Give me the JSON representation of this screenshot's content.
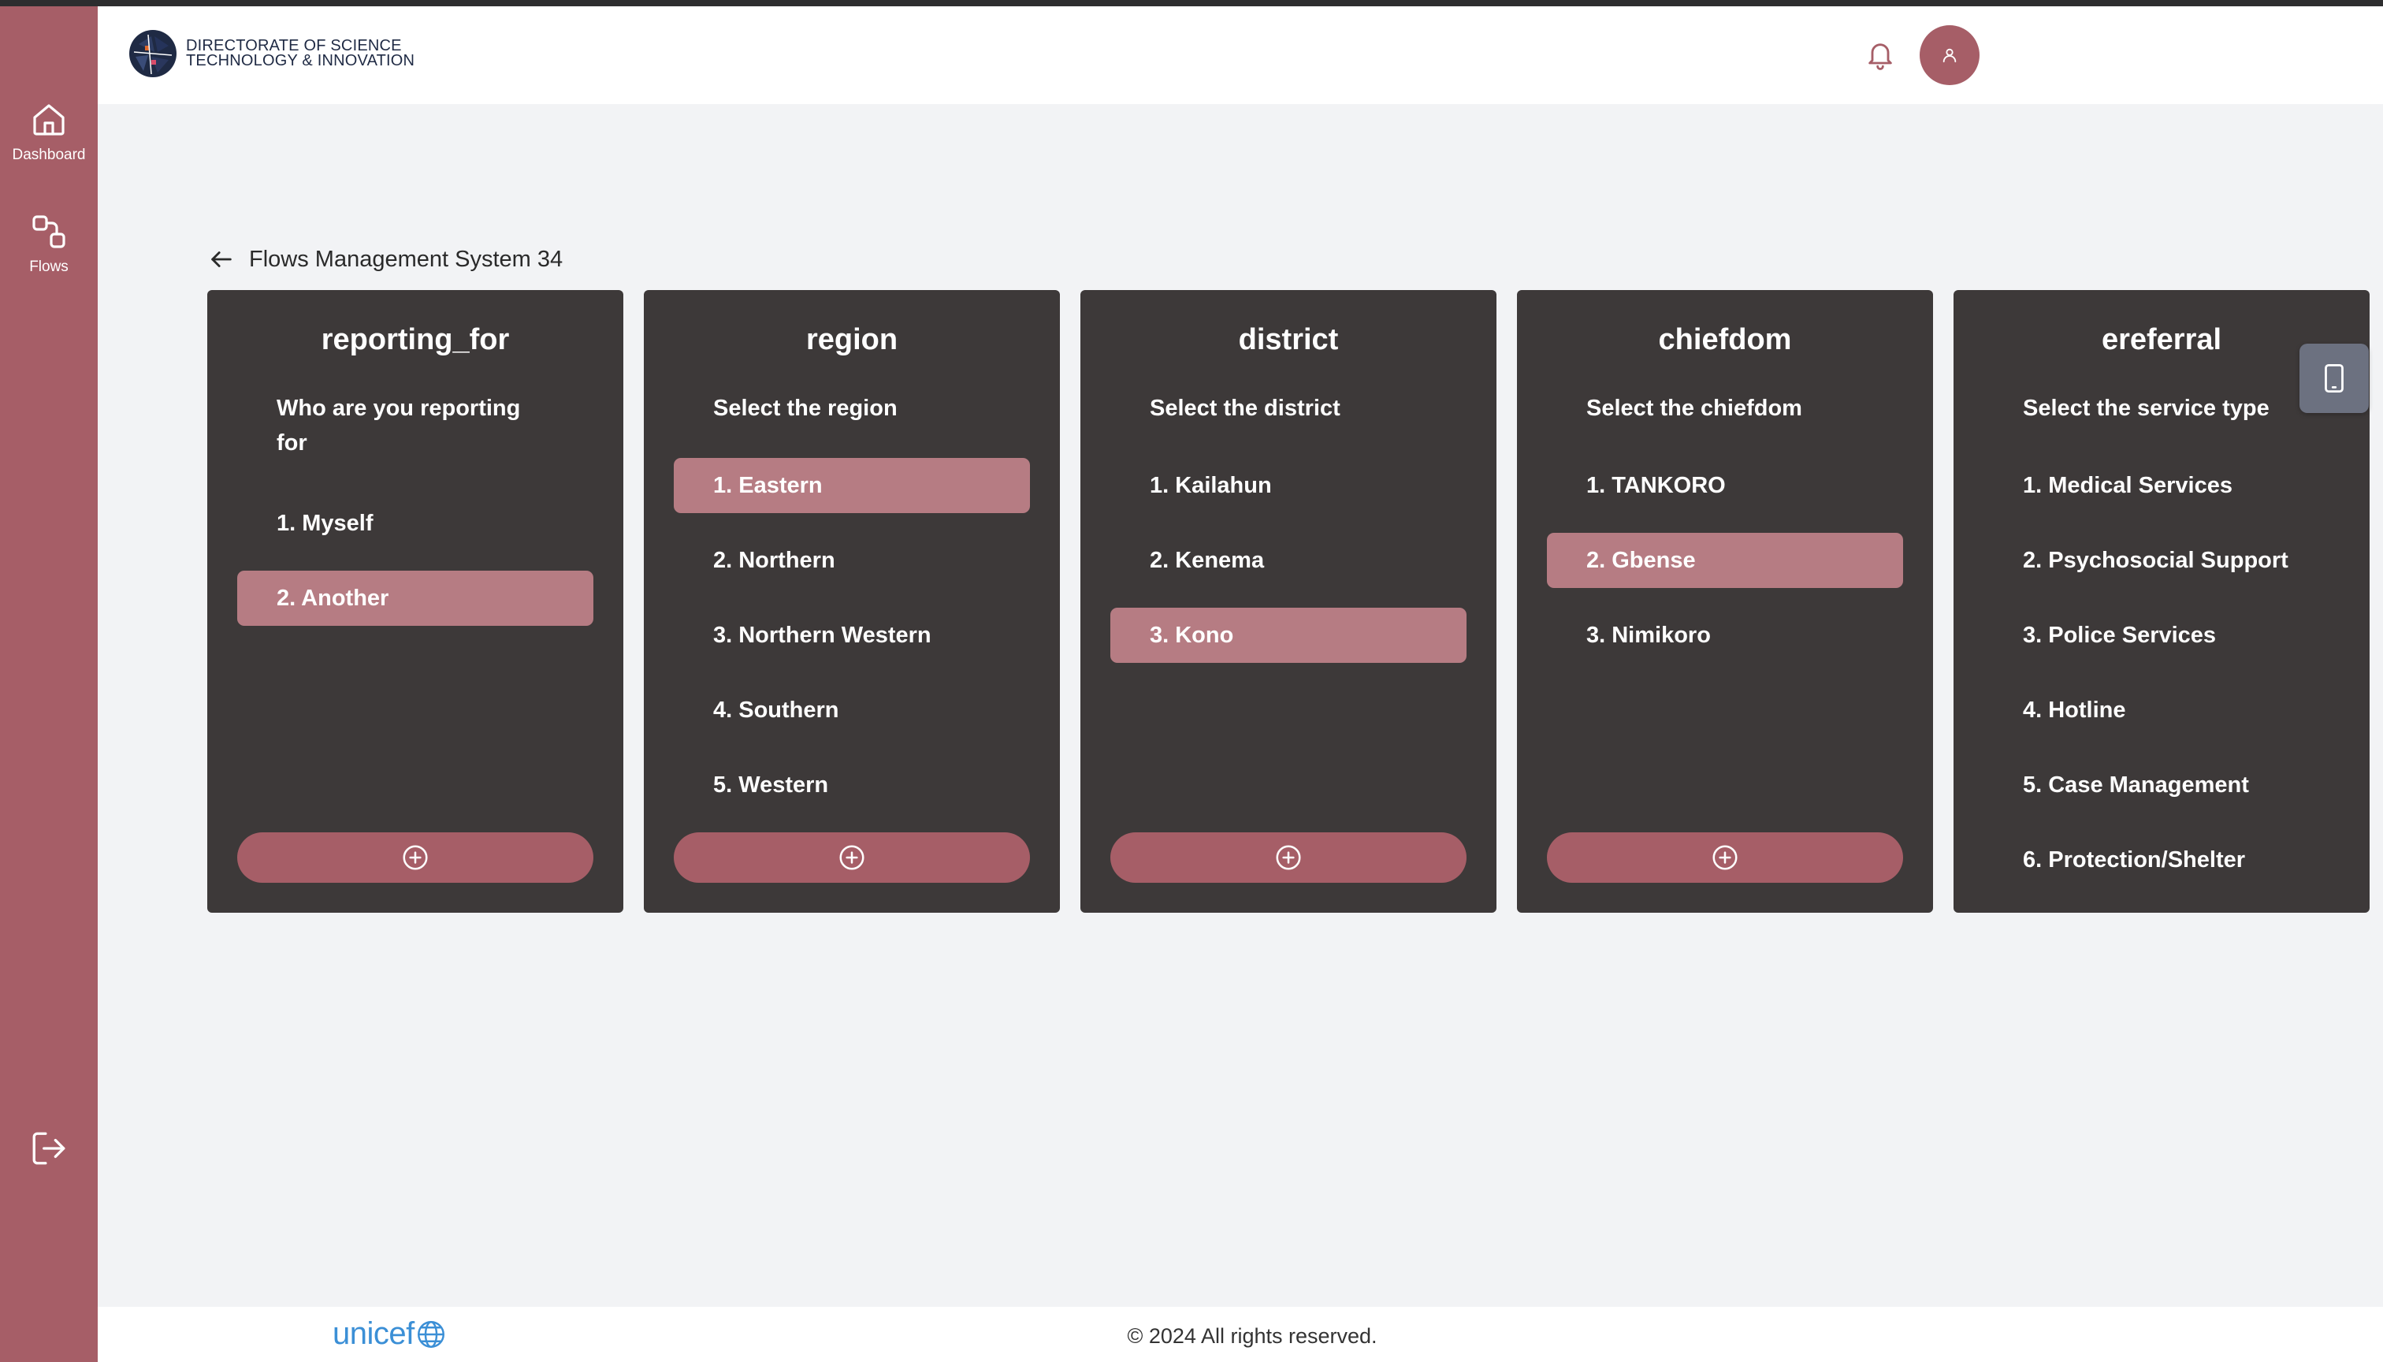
{
  "app": {
    "logo_line1": "DIRECTORATE OF SCIENCE",
    "logo_line2": "TECHNOLOGY & INNOVATION",
    "accent_color": "#a65e67",
    "selected_color": "#b67c83",
    "card_color": "#3d3939"
  },
  "sidebar": {
    "items": [
      {
        "label": "Dashboard",
        "icon": "home-icon"
      },
      {
        "label": "Flows",
        "icon": "flows-icon"
      }
    ],
    "logout_icon": "logout-icon"
  },
  "header": {
    "notification_icon": "bell-icon",
    "avatar_icon": "user-icon"
  },
  "breadcrumb": {
    "title": "Flows Management System 34"
  },
  "flows": [
    {
      "title": "reporting_for",
      "question": "Who are you reporting for",
      "options": [
        "1. Myself",
        "2. Another"
      ],
      "selected_index": 1,
      "has_add": true
    },
    {
      "title": "region",
      "question": "Select the region",
      "options": [
        "1. Eastern",
        "2. Northern",
        "3. Northern Western",
        "4. Southern",
        "5. Western"
      ],
      "selected_index": 0,
      "has_add": true
    },
    {
      "title": "district",
      "question": "Select the district",
      "options": [
        "1. Kailahun",
        "2. Kenema",
        "3. Kono"
      ],
      "selected_index": 2,
      "has_add": true
    },
    {
      "title": "chiefdom",
      "question": "Select the chiefdom",
      "options": [
        "1. TANKORO",
        "2. Gbense",
        "3. Nimikoro"
      ],
      "selected_index": 1,
      "has_add": true
    },
    {
      "title": "ereferral",
      "question": "Select the service type",
      "options": [
        "1. Medical Services",
        "2. Psychosocial Support",
        "3. Police Services",
        "4. Hotline",
        "5. Case Management",
        "6. Protection/Shelter"
      ],
      "selected_index": -1,
      "has_add": false
    }
  ],
  "footer": {
    "partner": "unicef",
    "copyright": "© 2024 All rights reserved."
  }
}
